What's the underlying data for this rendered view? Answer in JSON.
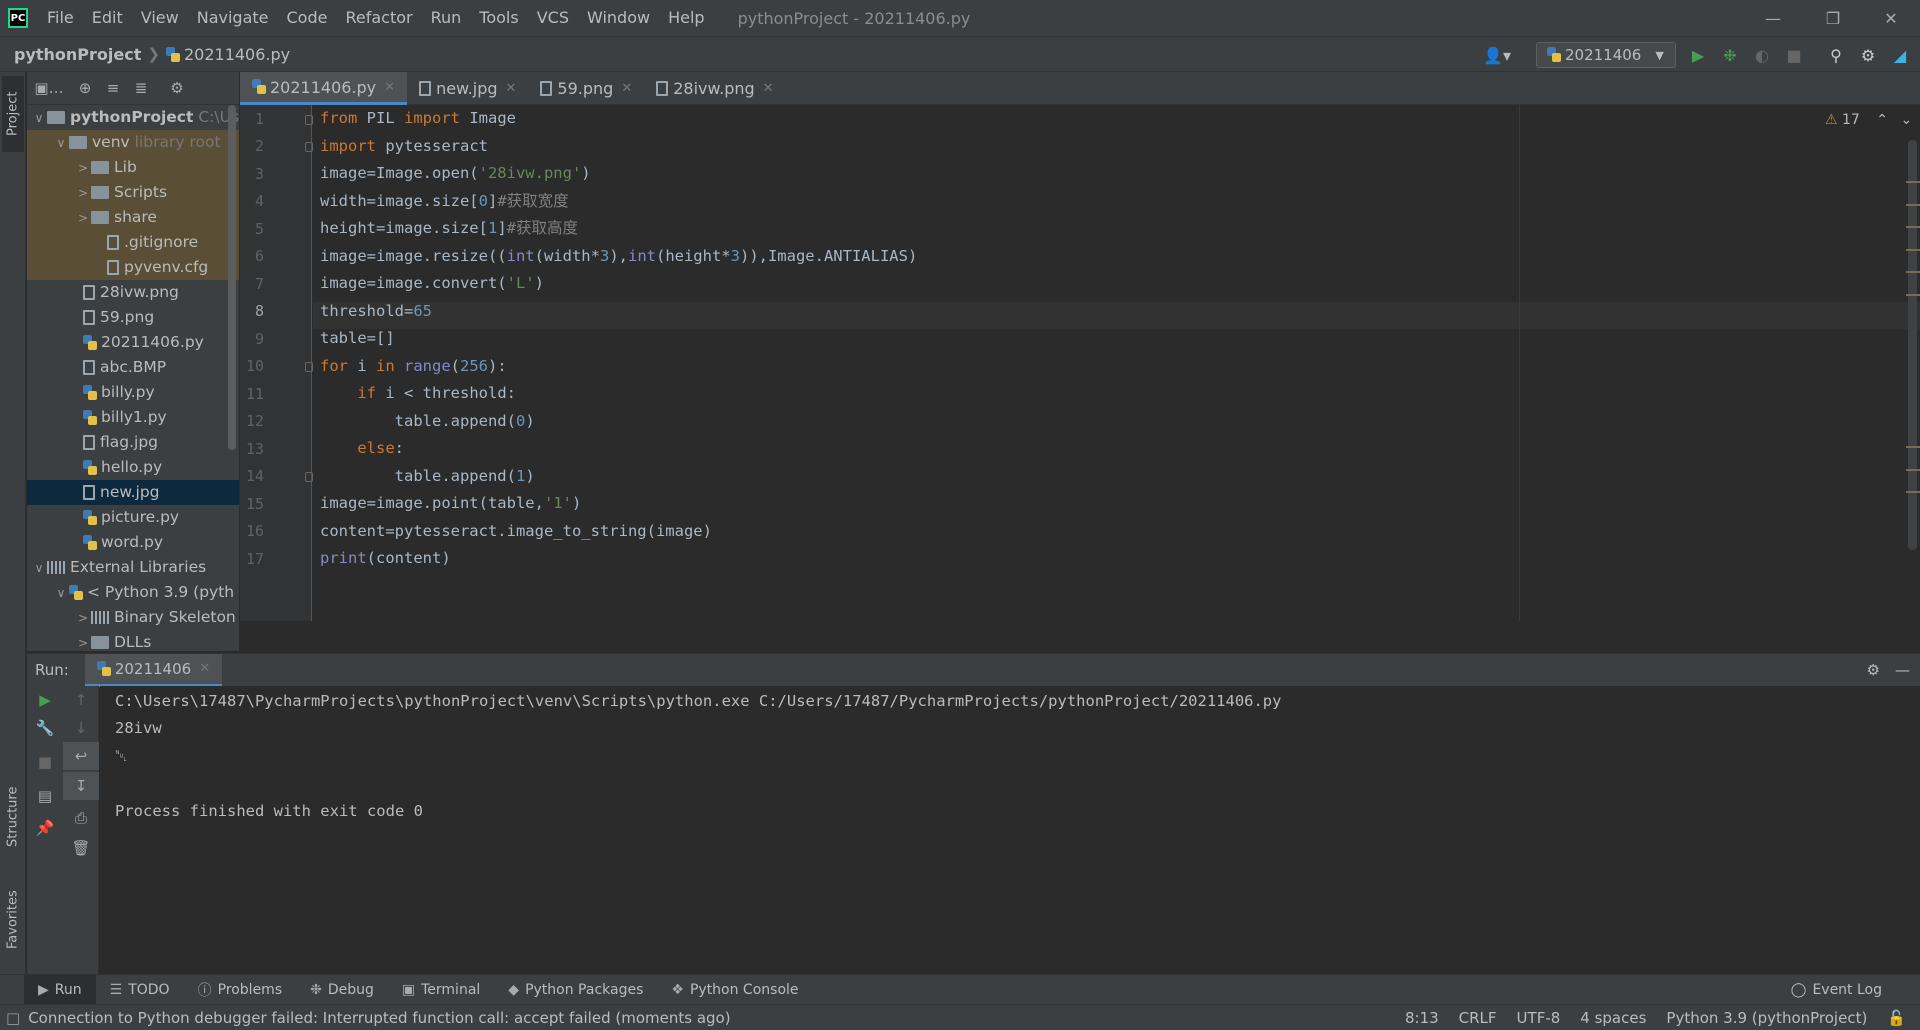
{
  "menu": {
    "items": [
      "File",
      "Edit",
      "View",
      "Navigate",
      "Code",
      "Refactor",
      "Run",
      "Tools",
      "VCS",
      "Window",
      "Help"
    ],
    "window_title": "pythonProject - 20211406.py"
  },
  "navbar": {
    "project": "pythonProject",
    "file": "20211406.py",
    "run_config": "20211406"
  },
  "sidebar": {
    "tabs": [
      "Project",
      "Structure",
      "Favorites"
    ]
  },
  "project_tree": [
    {
      "label": "pythonProject",
      "suffix": "C:\\Use"
    },
    {
      "label": "venv",
      "suffix": "library root"
    },
    {
      "label": "Lib"
    },
    {
      "label": "Scripts"
    },
    {
      "label": "share"
    },
    {
      "label": ".gitignore"
    },
    {
      "label": "pyvenv.cfg"
    },
    {
      "label": "28ivw.png"
    },
    {
      "label": "59.png"
    },
    {
      "label": "20211406.py"
    },
    {
      "label": "abc.BMP"
    },
    {
      "label": "billy.py"
    },
    {
      "label": "billy1.py"
    },
    {
      "label": "flag.jpg"
    },
    {
      "label": "hello.py"
    },
    {
      "label": "new.jpg"
    },
    {
      "label": "picture.py"
    },
    {
      "label": "word.py"
    },
    {
      "label": "External Libraries"
    },
    {
      "label": "< Python 3.9 (pyth"
    },
    {
      "label": "Binary Skeleton"
    },
    {
      "label": "DLLs"
    }
  ],
  "editor_tabs": [
    "20211406.py",
    "new.jpg",
    "59.png",
    "28ivw.png"
  ],
  "editor": {
    "line_numbers": [
      "1",
      "2",
      "3",
      "4",
      "5",
      "6",
      "7",
      "8",
      "9",
      "10",
      "11",
      "12",
      "13",
      "14",
      "15",
      "16",
      "17"
    ],
    "warnings": "17"
  },
  "run": {
    "label": "Run:",
    "tab": "20211406",
    "console": [
      "C:\\Users\\17487\\PycharmProjects\\pythonProject\\venv\\Scripts\\python.exe C:/Users/17487/PycharmProjects/pythonProject/20211406.py",
      "28ivw",
      "␀",
      "",
      "Process finished with exit code 0"
    ]
  },
  "toolwindows": [
    "Run",
    "TODO",
    "Problems",
    "Debug",
    "Terminal",
    "Python Packages",
    "Python Console"
  ],
  "event_log": "Event Log",
  "status": {
    "message": "Connection to Python debugger failed: Interrupted function call: accept failed (moments ago)",
    "position": "8:13",
    "line_sep": "CRLF",
    "encoding": "UTF-8",
    "indent": "4 spaces",
    "interpreter": "Python 3.9 (pythonProject)"
  }
}
